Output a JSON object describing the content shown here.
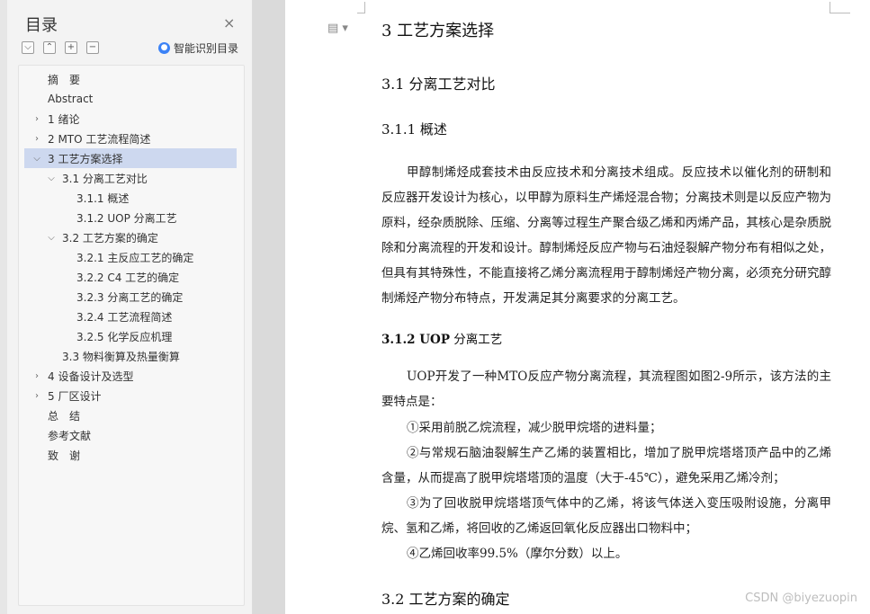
{
  "sidebar": {
    "title": "目录",
    "close_icon": "×",
    "smart_label": "智能识别目录",
    "tools": [
      "⌵",
      "⌃",
      "+",
      "−"
    ],
    "toc": [
      {
        "label": "摘　要",
        "level": 0,
        "toggle": ""
      },
      {
        "label": "Abstract",
        "level": 0,
        "toggle": ""
      },
      {
        "label": "1 绪论",
        "level": 0,
        "toggle": "›"
      },
      {
        "label": "2 MTO 工艺流程简述",
        "level": 0,
        "toggle": "›"
      },
      {
        "label": "3 工艺方案选择",
        "level": 0,
        "toggle": "⌵",
        "selected": true
      },
      {
        "label": "3.1 分离工艺对比",
        "level": 1,
        "toggle": "⌵"
      },
      {
        "label": "3.1.1 概述",
        "level": 2,
        "toggle": ""
      },
      {
        "label": "3.1.2 UOP 分离工艺",
        "level": 2,
        "toggle": ""
      },
      {
        "label": "3.2 工艺方案的确定",
        "level": 1,
        "toggle": "⌵"
      },
      {
        "label": "3.2.1 主反应工艺的确定",
        "level": 2,
        "toggle": ""
      },
      {
        "label": "3.2.2 C4 工艺的确定",
        "level": 2,
        "toggle": ""
      },
      {
        "label": "3.2.3 分离工艺的确定",
        "level": 2,
        "toggle": ""
      },
      {
        "label": "3.2.4 工艺流程简述",
        "level": 2,
        "toggle": ""
      },
      {
        "label": "3.2.5 化学反应机理",
        "level": 2,
        "toggle": ""
      },
      {
        "label": "3.3 物料衡算及热量衡算",
        "level": 1,
        "toggle": ""
      },
      {
        "label": "4 设备设计及选型",
        "level": 0,
        "toggle": "›"
      },
      {
        "label": "5 厂区设计",
        "level": 0,
        "toggle": "›"
      },
      {
        "label": "总　结",
        "level": 0,
        "toggle": ""
      },
      {
        "label": "参考文献",
        "level": 0,
        "toggle": ""
      },
      {
        "label": "致　谢",
        "level": 0,
        "toggle": ""
      }
    ]
  },
  "document": {
    "h1": "3 工艺方案选择",
    "h2": "3.1 分离工艺对比",
    "h3": "3.1.1 概述",
    "para1": "甲醇制烯烃成套技术由反应技术和分离技术组成。反应技术以催化剂的研制和反应器开发设计为核心，以甲醇为原料生产烯烃混合物；分离技术则是以反应产物为原料，经杂质脱除、压缩、分离等过程生产聚合级乙烯和丙烯产品，其核心是杂质脱除和分离流程的开发和设计。醇制烯烃反应产物与石油烃裂解产物分布有相似之处，但具有其特殊性，不能直接将乙烯分离流程用于醇制烯烃产物分离，必须充分研究醇制烯烃产物分布特点，开发满足其分离要求的分离工艺。",
    "h4_bold": "3.1.2 UOP",
    "h4_rest": " 分离工艺",
    "para2": "UOP开发了一种MTO反应产物分离流程，其流程图如图2-9所示，该方法的主要特点是：",
    "bullet1": "①采用前脱乙烷流程，减少脱甲烷塔的进料量；",
    "bullet2": "②与常规石脑油裂解生产乙烯的装置相比，增加了脱甲烷塔塔顶产品中的乙烯含量，从而提高了脱甲烷塔塔顶的温度（大于-45℃），避免采用乙烯冷剂；",
    "bullet3": "③为了回收脱甲烷塔塔顶气体中的乙烯，将该气体送入变压吸附设施，分离甲烷、氢和乙烯，将回收的乙烯返回氧化反应器出口物料中；",
    "bullet4": "④乙烯回收率99.5%（摩尔分数）以上。",
    "h5": "3.2 工艺方案的确定"
  },
  "watermark": "CSDN @biyezuopin"
}
